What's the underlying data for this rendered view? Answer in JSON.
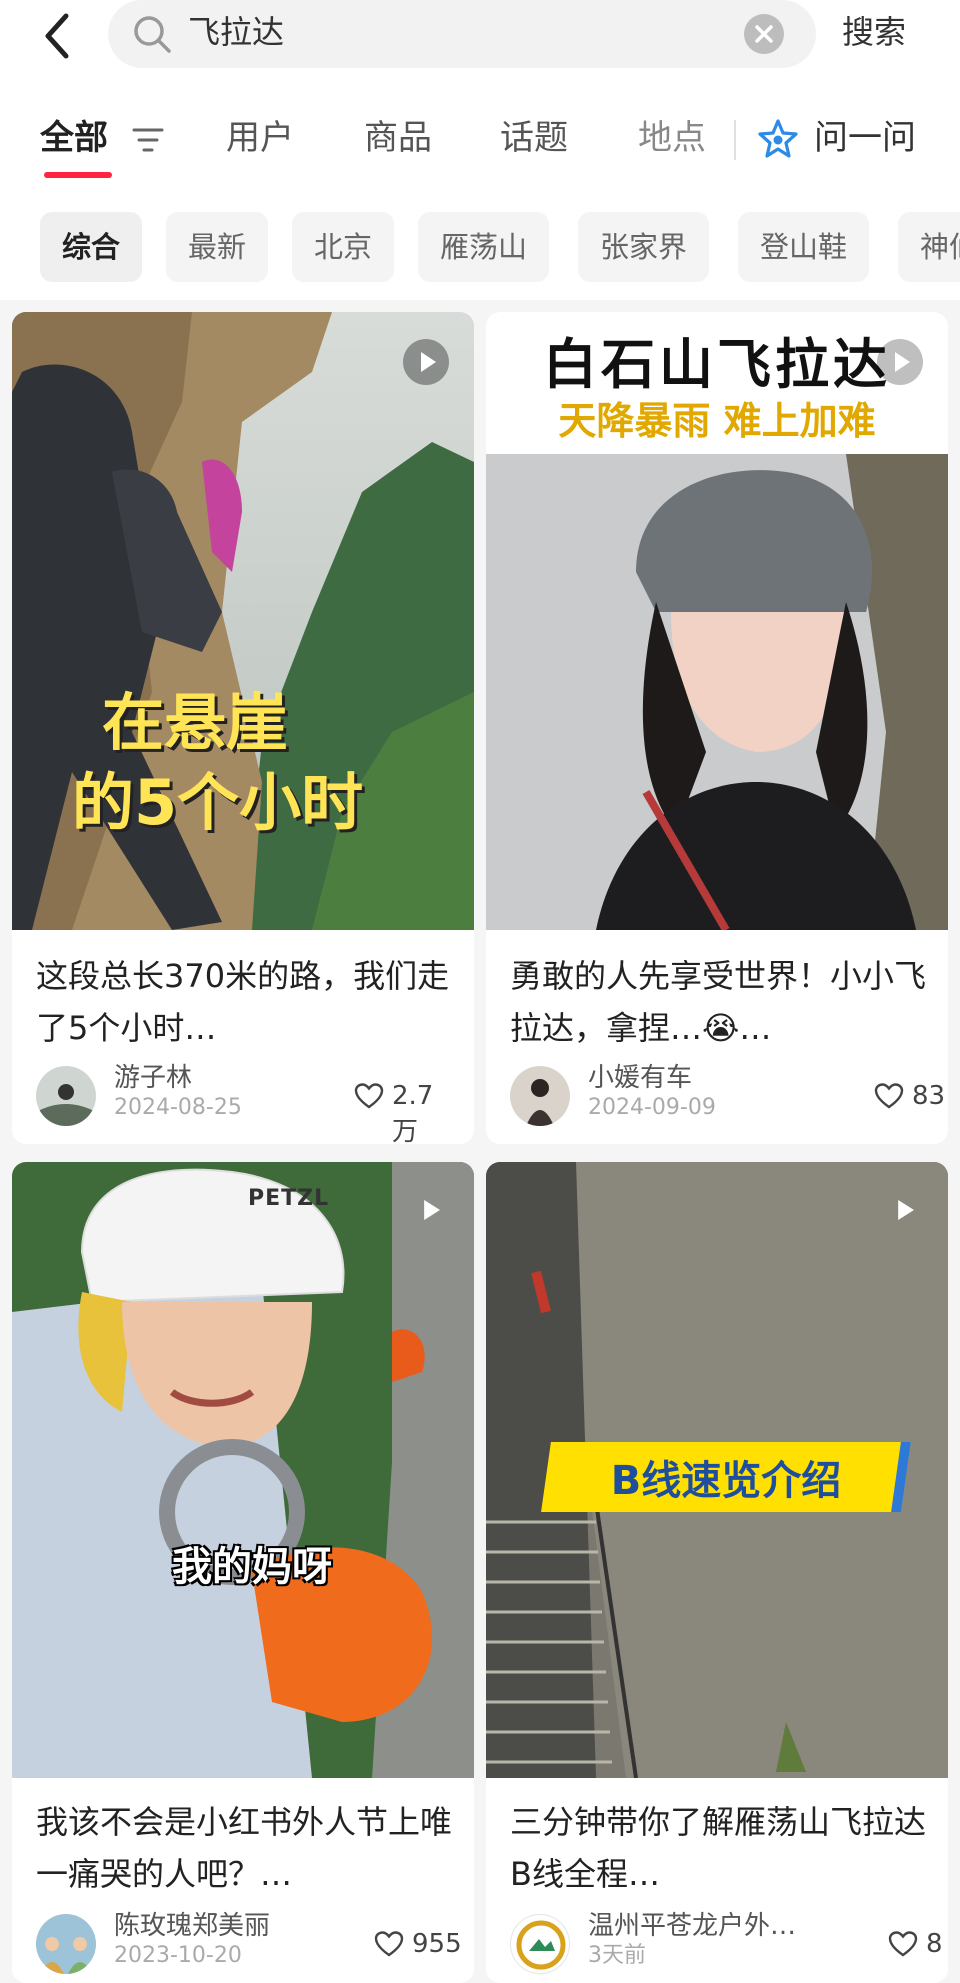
{
  "search": {
    "query": "飞拉达",
    "submit_label": "搜索"
  },
  "tabs": {
    "items": [
      "全部",
      "用户",
      "商品",
      "话题",
      "地点"
    ],
    "active": "全部",
    "ask_label": "问一问"
  },
  "chips": [
    "综合",
    "最新",
    "北京",
    "雁荡山",
    "张家界",
    "登山鞋",
    "神仙"
  ],
  "colors": {
    "accent": "#ff2442",
    "ask_icon": "#2b8be6"
  },
  "posts": [
    {
      "title": "这段总长370米的路，我们走了5个小时…",
      "author": "游子林",
      "date": "2024-08-25",
      "likes": "2.7万",
      "overlay": [
        "在悬崖",
        "的5个小时"
      ]
    },
    {
      "title": "勇敢的人先享受世界！小小飞拉达，拿捏…😭…",
      "author": "小媛有车",
      "date": "2024-09-09",
      "likes": "83",
      "overlay": [
        "白石山飞拉达",
        "天降暴雨 难上加难"
      ]
    },
    {
      "title": "我该不会是小红书外人节上唯一痛哭的人吧？…",
      "author": "陈玫瑰郑美丽",
      "date": "2023-10-20",
      "likes": "955",
      "overlay": [
        "我的妈呀"
      ],
      "helmet_brand": "PETZL"
    },
    {
      "title": "三分钟带你了解雁荡山飞拉达B线全程…",
      "author": "温州平苍龙户外…",
      "date": "3天前",
      "likes": "8",
      "overlay": [
        "B线速览介绍"
      ]
    }
  ]
}
